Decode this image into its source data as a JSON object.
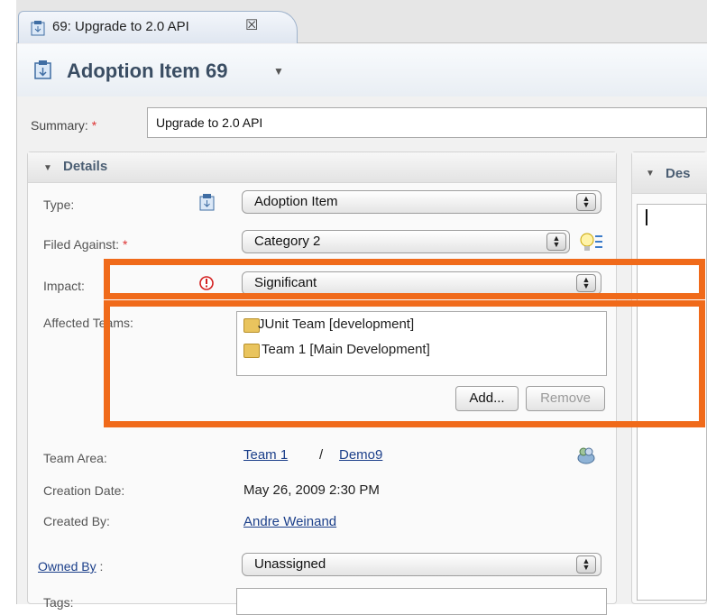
{
  "tab": {
    "label": "69: Upgrade to 2.0 API",
    "icon": "work-item-icon",
    "close": "☒"
  },
  "header": {
    "title": "Adoption Item 69",
    "icon": "work-item-icon"
  },
  "summary": {
    "label": "Summary:",
    "required": "*",
    "value": "Upgrade to 2.0 API"
  },
  "details": {
    "title": "Details",
    "type": {
      "label": "Type:",
      "value": "Adoption Item"
    },
    "filed_against": {
      "label": "Filed Against:",
      "required": "*",
      "value": "Category 2"
    },
    "impact": {
      "label": "Impact:",
      "value": "Significant",
      "icon": "warning-icon"
    },
    "affected_teams": {
      "label": "Affected Teams:",
      "items": [
        "JUnit Team [development]",
        "Team 1 [Main Development]"
      ],
      "add_label": "Add...",
      "remove_label": "Remove"
    },
    "team_area": {
      "label": "Team Area:",
      "team": "Team 1",
      "separator": "/",
      "project": "Demo9"
    },
    "creation_date": {
      "label": "Creation Date:",
      "value": "May 26, 2009 2:30 PM"
    },
    "created_by": {
      "label": "Created By:",
      "value": "Andre Weinand"
    },
    "owned_by": {
      "label": "Owned By",
      "colon": ":",
      "value": "Unassigned"
    },
    "tags": {
      "label": "Tags:"
    }
  },
  "description": {
    "title": "Des"
  },
  "colors": {
    "highlight": "#f06a1a",
    "link": "#1b3f8a",
    "required": "#dd3333"
  }
}
